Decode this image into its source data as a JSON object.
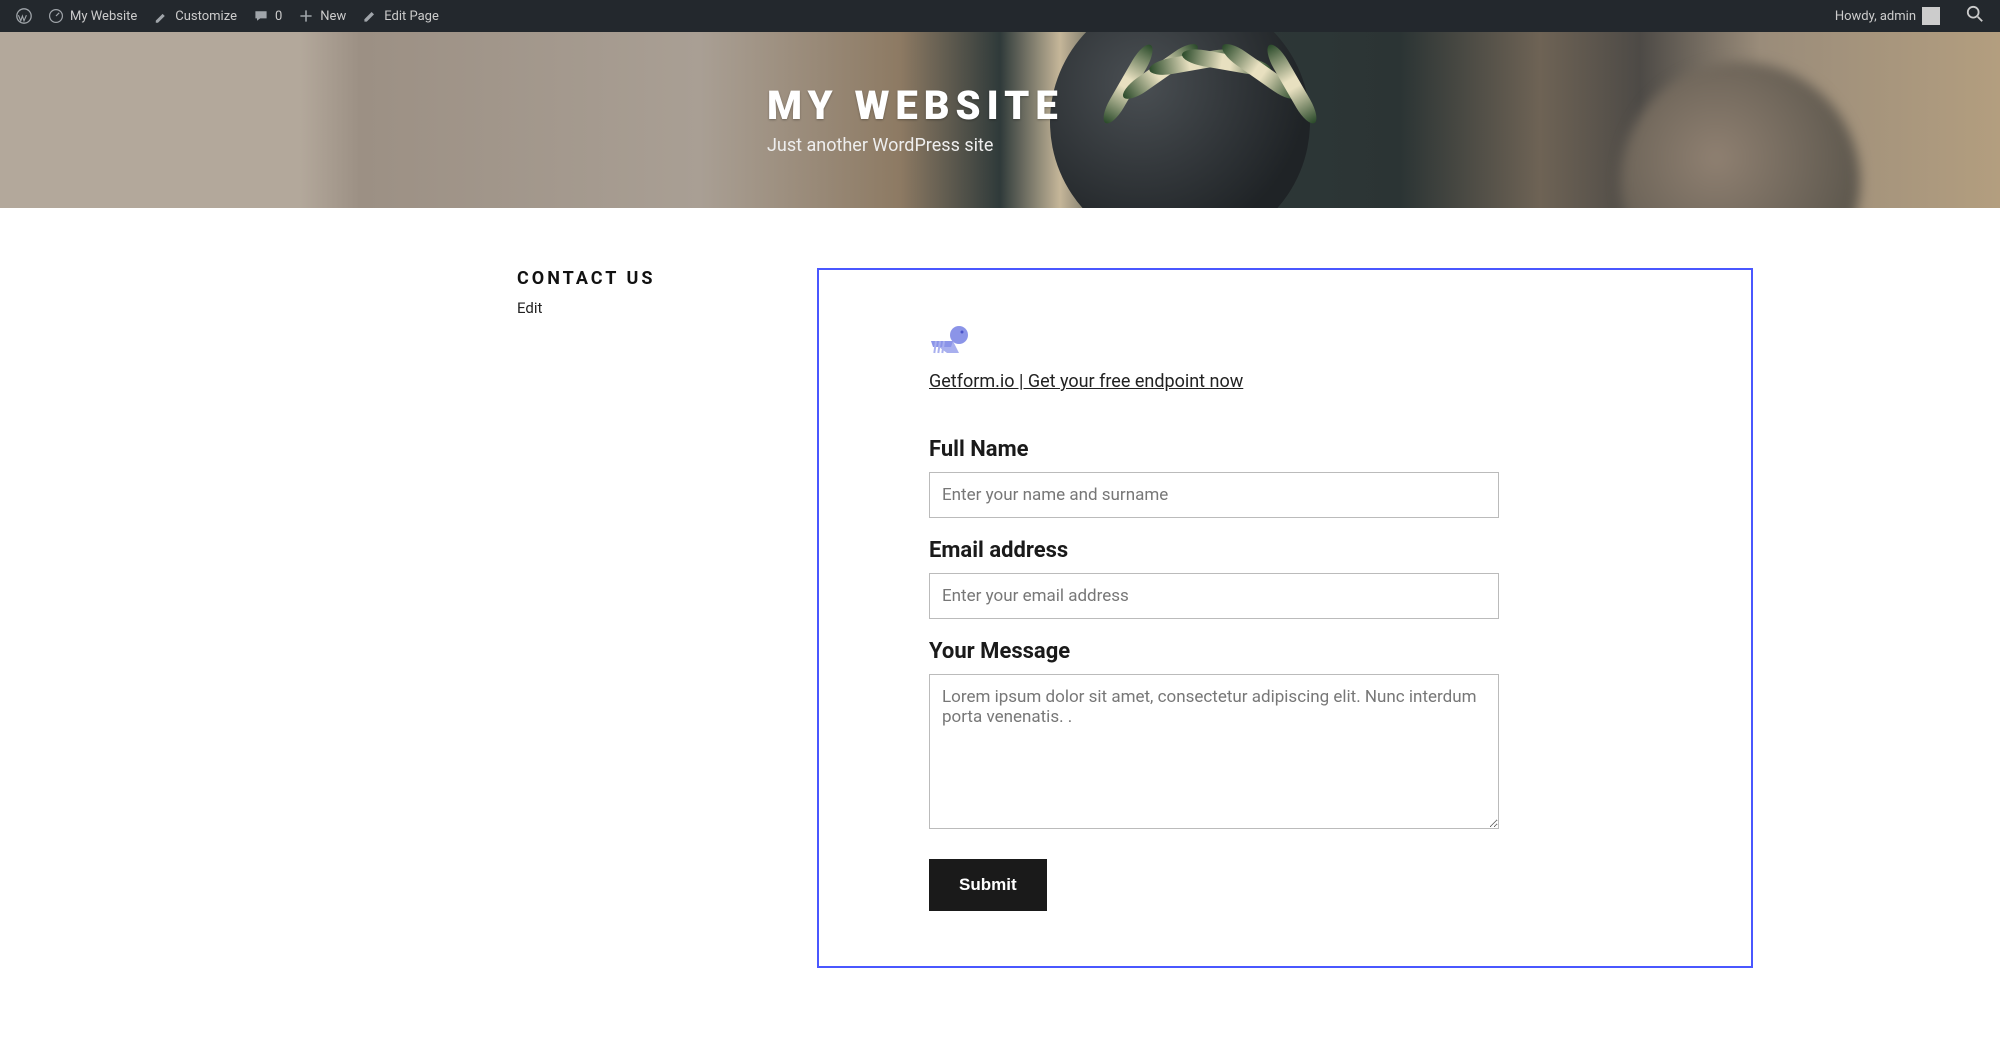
{
  "adminbar": {
    "site_name": "My Website",
    "customize": "Customize",
    "comments_count": "0",
    "new_label": "New",
    "edit_page": "Edit Page",
    "howdy": "Howdy, admin"
  },
  "hero": {
    "title": "MY WEBSITE",
    "tagline": "Just another WordPress site"
  },
  "page": {
    "title": "CONTACT US",
    "edit": "Edit"
  },
  "form": {
    "getform_link": "Getform.io | Get your free endpoint now",
    "name_label": "Full Name",
    "name_placeholder": "Enter your name and surname",
    "name_value": "",
    "email_label": "Email address",
    "email_placeholder": "Enter your email address",
    "email_value": "",
    "message_label": "Your Message",
    "message_placeholder": "Lorem ipsum dolor sit amet, consectetur adipiscing elit. Nunc interdum porta venenatis. .",
    "message_value": "",
    "submit": "Submit"
  }
}
